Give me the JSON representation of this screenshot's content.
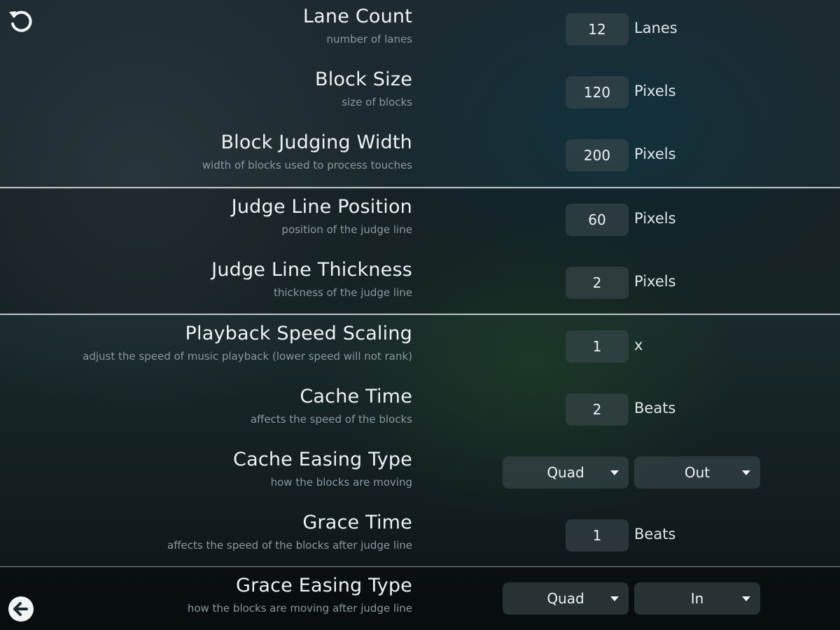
{
  "icons": {
    "reset": "reset-icon",
    "back": "back-arrow-icon"
  },
  "settings": [
    {
      "label": "Lane Count",
      "description": "number of lanes",
      "value": "12",
      "unit": "Lanes"
    },
    {
      "label": "Block Size",
      "description": "size of blocks",
      "value": "120",
      "unit": "Pixels"
    },
    {
      "label": "Block Judging Width",
      "description": "width of blocks used to process touches",
      "value": "200",
      "unit": "Pixels"
    },
    {
      "label": "Judge Line Position",
      "description": "position of the judge line",
      "value": "60",
      "unit": "Pixels"
    },
    {
      "label": "Judge Line Thickness",
      "description": "thickness of the judge line",
      "value": "2",
      "unit": "Pixels"
    },
    {
      "label": "Playback Speed Scaling",
      "description": "adjust the speed of music playback (lower speed will not rank)",
      "value": "1",
      "unit": "x"
    },
    {
      "label": "Cache Time",
      "description": "affects the speed of the blocks",
      "value": "2",
      "unit": "Beats"
    },
    {
      "label": "Cache Easing Type",
      "description": "how the blocks are moving",
      "easing": "Quad",
      "direction": "Out"
    },
    {
      "label": "Grace Time",
      "description": "affects the speed of the blocks after judge line",
      "value": "1",
      "unit": "Beats"
    },
    {
      "label": "Grace Easing Type",
      "description": "how the blocks are moving after judge line",
      "easing": "Quad",
      "direction": "In"
    }
  ],
  "colors": {
    "divider": "#dce1e4",
    "field": "#3a484c",
    "text": "#eef2f4",
    "subtext": "#8a979d"
  }
}
